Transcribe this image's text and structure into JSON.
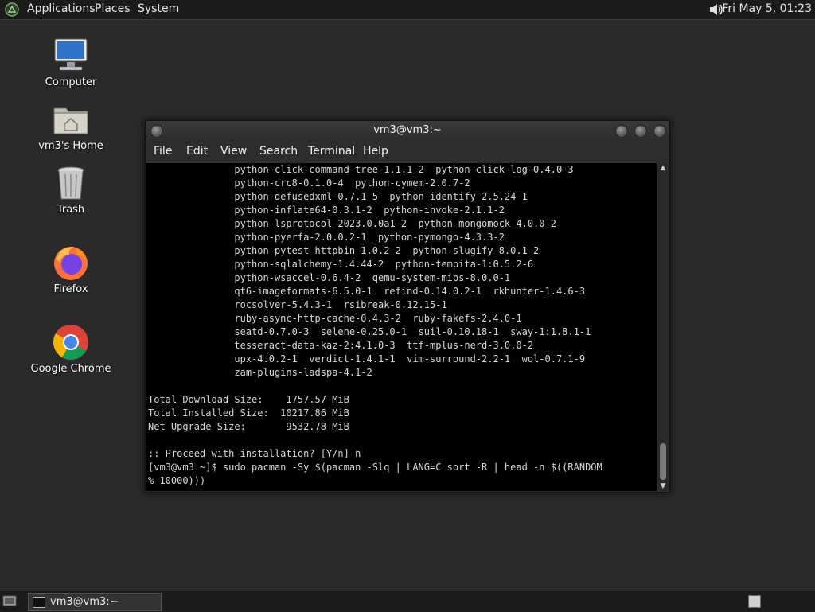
{
  "top_panel": {
    "menus": [
      "Applications",
      "Places",
      "System"
    ],
    "clock": "Fri May  5, 01:23",
    "volume_icon": "speaker-icon"
  },
  "desktop": {
    "icons": [
      {
        "label": "Computer",
        "icon": "computer-icon"
      },
      {
        "label": "vm3's Home",
        "icon": "home-folder-icon"
      },
      {
        "label": "Trash",
        "icon": "trash-icon"
      },
      {
        "label": "Firefox",
        "icon": "firefox-icon"
      },
      {
        "label": "Google Chrome",
        "icon": "chrome-icon"
      }
    ]
  },
  "terminal_window": {
    "title": "vm3@vm3:~",
    "menu": [
      "File",
      "Edit",
      "View",
      "Search",
      "Terminal",
      "Help"
    ],
    "lines": [
      "               python-click-command-tree-1.1.1-2  python-click-log-0.4.0-3",
      "               python-crc8-0.1.0-4  python-cymem-2.0.7-2",
      "               python-defusedxml-0.7.1-5  python-identify-2.5.24-1",
      "               python-inflate64-0.3.1-2  python-invoke-2.1.1-2",
      "               python-lsprotocol-2023.0.0a1-2  python-mongomock-4.0.0-2",
      "               python-pyerfa-2.0.0.2-1  python-pymongo-4.3.3-2",
      "               python-pytest-httpbin-1.0.2-2  python-slugify-8.0.1-2",
      "               python-sqlalchemy-1.4.44-2  python-tempita-1:0.5.2-6",
      "               python-wsaccel-0.6.4-2  qemu-system-mips-8.0.0-1",
      "               qt6-imageformats-6.5.0-1  refind-0.14.0.2-1  rkhunter-1.4.6-3",
      "               rocsolver-5.4.3-1  rsibreak-0.12.15-1",
      "               ruby-async-http-cache-0.4.3-2  ruby-fakefs-2.4.0-1",
      "               seatd-0.7.0-3  selene-0.25.0-1  suil-0.10.18-1  sway-1:1.8.1-1",
      "               tesseract-data-kaz-2:4.1.0-3  ttf-mplus-nerd-3.0.0-2",
      "               upx-4.0.2-1  verdict-1.4.1-1  vim-surround-2.2-1  wol-0.7.1-9",
      "               zam-plugins-ladspa-4.1-2",
      "",
      "Total Download Size:    1757.57 MiB",
      "Total Installed Size:  10217.86 MiB",
      "Net Upgrade Size:       9532.78 MiB",
      "",
      ":: Proceed with installation? [Y/n] n",
      "[vm3@vm3 ~]$ sudo pacman -Sy $(pacman -Slq | LANG=C sort -R | head -n $((RANDOM",
      "% 10000)))"
    ]
  },
  "bottom_panel": {
    "taskbar": [
      {
        "label": "vm3@vm3:~",
        "icon": "terminal-icon"
      }
    ],
    "show_desktop_icon": "show-desktop-icon",
    "workspace_icon": "workspace-switcher-icon"
  }
}
